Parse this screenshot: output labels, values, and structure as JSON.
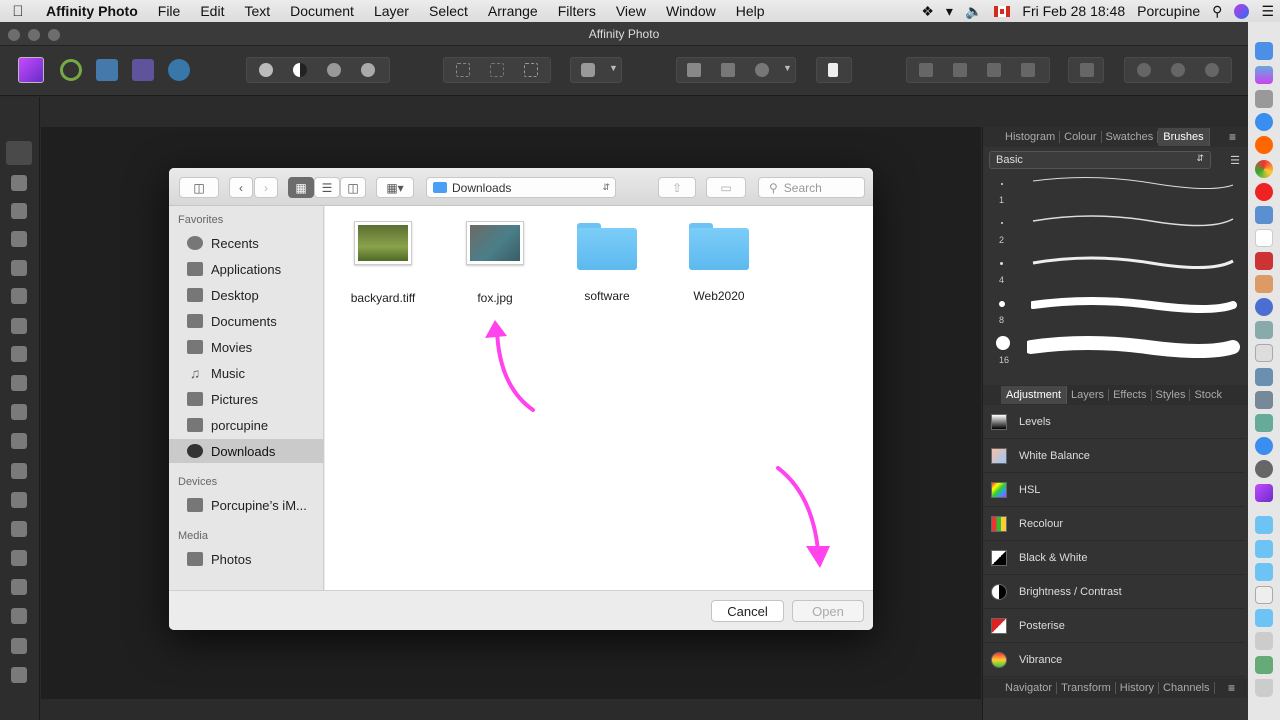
{
  "menubar": {
    "app": "Affinity Photo",
    "items": [
      "File",
      "Edit",
      "Text",
      "Document",
      "Layer",
      "Select",
      "Arrange",
      "Filters",
      "View",
      "Window",
      "Help"
    ],
    "clock": "Fri Feb 28  18:48",
    "user": "Porcupine"
  },
  "window": {
    "title": "Affinity Photo"
  },
  "panel": {
    "top_tabs": [
      "Histogram",
      "Colour",
      "Swatches",
      "Brushes"
    ],
    "active_top_tab": "Brushes",
    "brush_category": "Basic",
    "brush_sizes": [
      "1",
      "2",
      "4",
      "8",
      "16"
    ],
    "mid_tabs": [
      "Adjustment",
      "Layers",
      "Effects",
      "Styles",
      "Stock"
    ],
    "active_mid_tab": "Adjustment",
    "adjustments": [
      "Levels",
      "White Balance",
      "HSL",
      "Recolour",
      "Black & White",
      "Brightness / Contrast",
      "Posterise",
      "Vibrance"
    ],
    "bottom_tabs": [
      "Navigator",
      "Transform",
      "History",
      "Channels"
    ]
  },
  "dialog": {
    "location": "Downloads",
    "search_placeholder": "Search",
    "sidebar": {
      "favorites_header": "Favorites",
      "favorites": [
        "Recents",
        "Applications",
        "Desktop",
        "Documents",
        "Movies",
        "Music",
        "Pictures",
        "porcupine",
        "Downloads"
      ],
      "selected": "Downloads",
      "devices_header": "Devices",
      "devices": [
        "Porcupine’s iM..."
      ],
      "media_header": "Media",
      "media": [
        "Photos"
      ]
    },
    "files": [
      {
        "name": "backyard.tiff",
        "kind": "image"
      },
      {
        "name": "fox.jpg",
        "kind": "image"
      },
      {
        "name": "software",
        "kind": "folder"
      },
      {
        "name": "Web2020",
        "kind": "folder"
      }
    ],
    "cancel_label": "Cancel",
    "open_label": "Open"
  },
  "colors": {
    "annotation_arrow": "#ff44ee",
    "folder_blue": "#6cc3f4",
    "selection": "#cacaca"
  }
}
